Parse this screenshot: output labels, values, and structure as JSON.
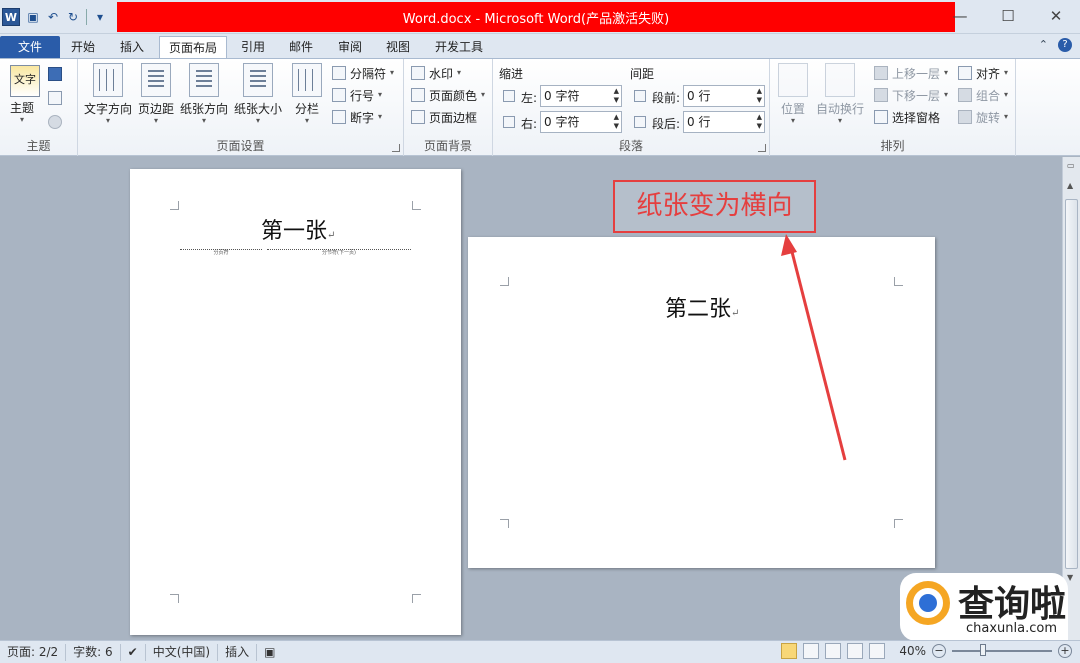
{
  "titlebar": {
    "title": "Word.docx - Microsoft Word(产品激活失败)",
    "logo": "W",
    "qat_icons": [
      "save-icon",
      "undo-icon",
      "redo-icon",
      "customize-icon"
    ],
    "minimize": "—",
    "maximize": "☐",
    "close": "✕"
  },
  "tabs": {
    "file": "文件",
    "items": [
      "开始",
      "插入",
      "页面布局",
      "引用",
      "邮件",
      "审阅",
      "视图",
      "开发工具"
    ],
    "active": "页面布局"
  },
  "ribbon": {
    "themes": {
      "label": "主题",
      "big_button": "主题",
      "icon_text": "文字"
    },
    "page_setup": {
      "label": "页面设置",
      "buttons": [
        "文字方向",
        "页边距",
        "纸张方向",
        "纸张大小",
        "分栏"
      ],
      "small": [
        "分隔符",
        "行号",
        "断字"
      ]
    },
    "page_background": {
      "label": "页面背景",
      "small": [
        "水印",
        "页面颜色",
        "页面边框"
      ]
    },
    "paragraph": {
      "label": "段落",
      "indent_title": "缩进",
      "spacing_title": "间距",
      "left_label": "左:",
      "right_label": "右:",
      "before_label": "段前:",
      "after_label": "段后:",
      "left_value": "0 字符",
      "right_value": "0 字符",
      "before_value": "0 行",
      "after_value": "0 行"
    },
    "arrange": {
      "label": "排列",
      "position": "位置",
      "wrap": "自动换行",
      "bring_forward": "上移一层",
      "send_backward": "下移一层",
      "selection_pane": "选择窗格",
      "align": "对齐",
      "group": "组合",
      "rotate": "旋转"
    }
  },
  "document": {
    "page1_heading": "第一张",
    "page_break_label": "分页符",
    "section_break_label": "分节符(下一页)",
    "page2_heading": "第二张",
    "paragraph_mark": "↵"
  },
  "annotation": {
    "text": "纸张变为横向",
    "color": "#e53f3f"
  },
  "watermark": {
    "text": "查询啦",
    "url": "chaxunla.com"
  },
  "statusbar": {
    "page": "页面: 2/2",
    "words": "字数: 6",
    "language": "中文(中国)",
    "mode": "插入",
    "zoom": "40%",
    "zoom_level": 0.4
  }
}
